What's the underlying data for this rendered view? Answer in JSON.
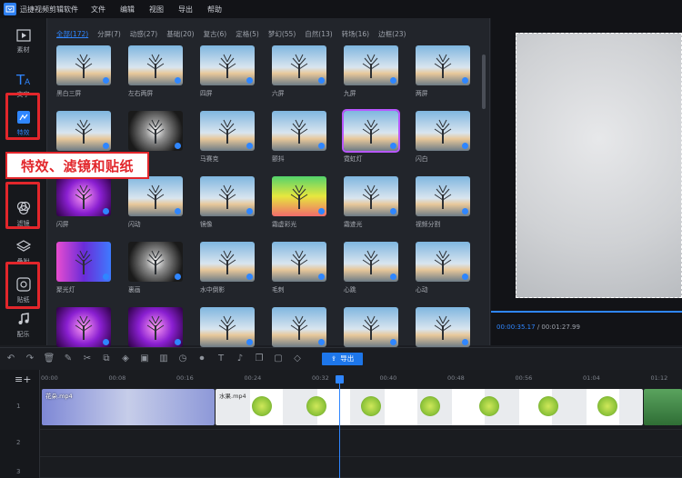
{
  "app": {
    "title": "迅捷视频剪辑软件"
  },
  "menu": [
    "文件",
    "编辑",
    "视图",
    "导出",
    "帮助"
  ],
  "rail": [
    {
      "label": "素材",
      "icon": "media-icon"
    },
    {
      "label": "文字",
      "icon": "text-icon"
    },
    {
      "label": "特效",
      "icon": "effects-icon",
      "active": true
    },
    {
      "label": "滤镜",
      "icon": "filter-icon"
    },
    {
      "label": "叠附",
      "icon": "layers-icon"
    },
    {
      "label": "贴纸",
      "icon": "sticker-icon"
    },
    {
      "label": "配乐",
      "icon": "music-icon"
    }
  ],
  "banner": "特效、滤镜和贴纸",
  "tabs": [
    "全部(172)",
    "分屏(7)",
    "动感(27)",
    "基础(20)",
    "复古(6)",
    "定格(5)",
    "梦幻(55)",
    "自然(13)",
    "转场(16)",
    "边框(23)"
  ],
  "effects": [
    [
      "黑白三屏",
      "左右两屏",
      "四屏",
      "六屏",
      "九屏",
      "两屏"
    ],
    [
      "",
      "画",
      "马赛克",
      "颤抖",
      "霓虹灯",
      "闪白"
    ],
    [
      "闪屏",
      "闪动",
      "镜像",
      "霜虚彩光",
      "霜迹光",
      "视频分割"
    ],
    [
      "聚光灯",
      "裏画",
      "水中倒影",
      "毛刺",
      "心跳",
      "心动"
    ],
    [
      "",
      "",
      "",
      "",
      "",
      ""
    ]
  ],
  "preview": {
    "current": "00:00:35.17",
    "total": "/ 00:01:27.99"
  },
  "toolbar": {
    "export": "导出"
  },
  "ruler": [
    "00:00",
    "00:08",
    "00:16",
    "00:24",
    "00:32",
    "00:40",
    "00:48",
    "00:56",
    "01:04",
    "01:12"
  ],
  "clips": {
    "clip1": "花朵.mp4",
    "clip2": "水果.mp4"
  },
  "track_labels": [
    "1",
    "2",
    "3"
  ]
}
